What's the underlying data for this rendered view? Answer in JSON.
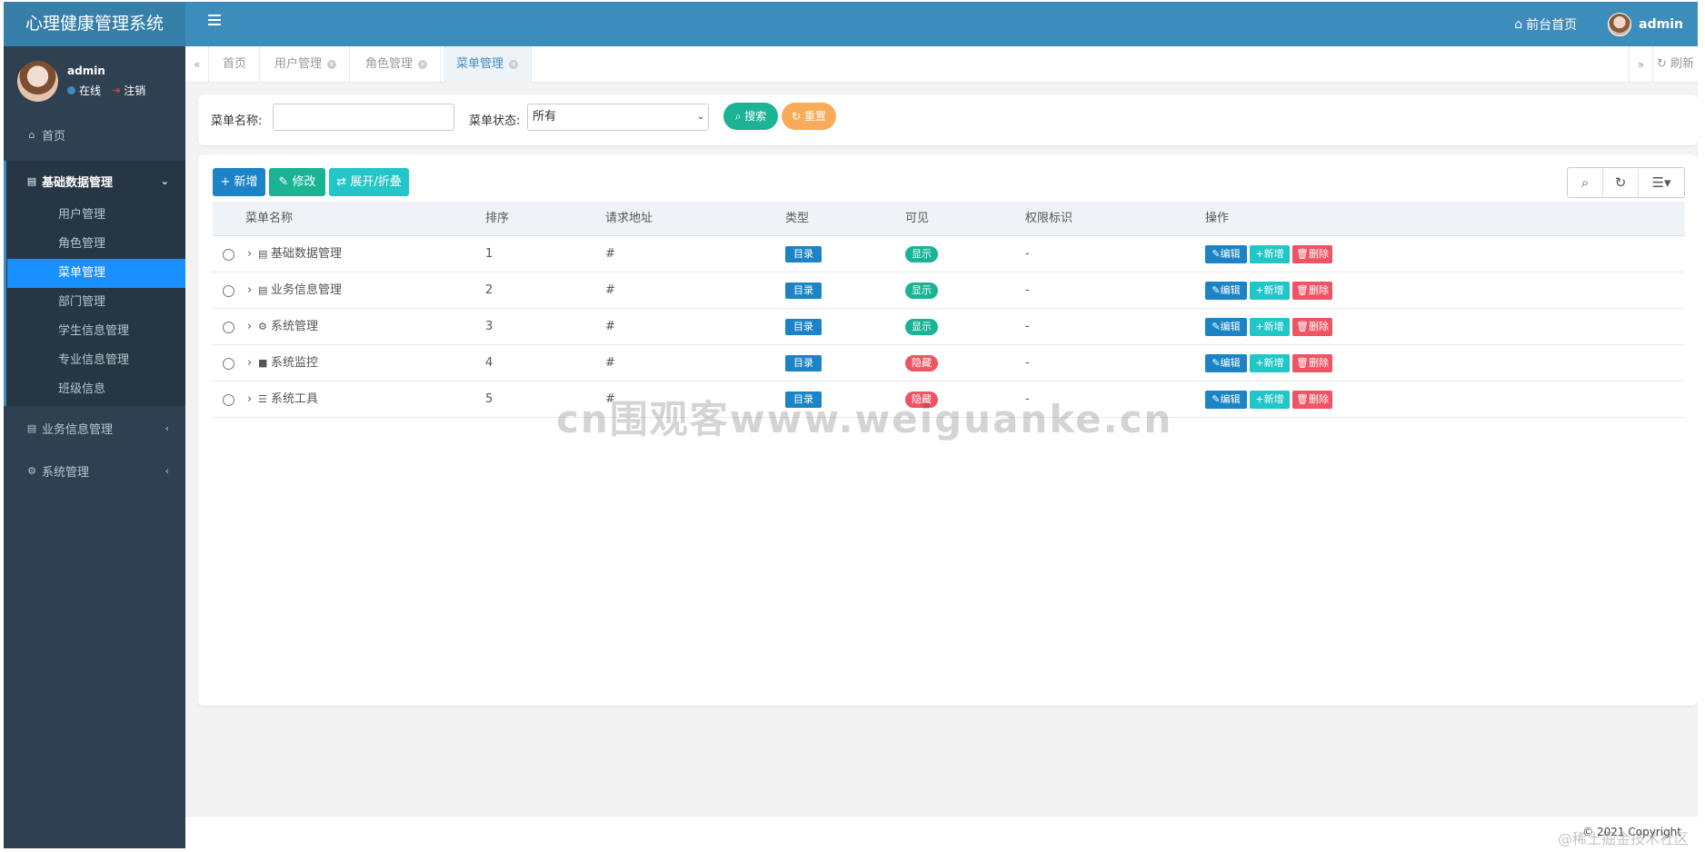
{
  "header": {
    "brand": "心理健康管理系统",
    "home_link": "前台首页",
    "user_name": "admin"
  },
  "sidebar": {
    "user": {
      "name": "admin",
      "status": "在线",
      "logout": "注销"
    },
    "home": "首页",
    "group_basic": "基础数据管理",
    "basic_items": [
      "用户管理",
      "角色管理",
      "菜单管理",
      "部门管理",
      "学生信息管理",
      "专业信息管理",
      "班级信息"
    ],
    "active_item": "菜单管理",
    "group_business": "业务信息管理",
    "group_system": "系统管理"
  },
  "tabs": {
    "items": [
      {
        "label": "首页",
        "closable": false
      },
      {
        "label": "用户管理",
        "closable": true
      },
      {
        "label": "角色管理",
        "closable": true
      },
      {
        "label": "菜单管理",
        "closable": true
      }
    ],
    "active": "菜单管理",
    "refresh": "刷新"
  },
  "search": {
    "name_label": "菜单名称:",
    "name_value": "",
    "status_label": "菜单状态:",
    "status_selected": "所有",
    "search_btn": "搜索",
    "reset_btn": "重置"
  },
  "toolbar": {
    "add": "新增",
    "edit": "修改",
    "toggle": "展开/折叠"
  },
  "table": {
    "headers": [
      "菜单名称",
      "排序",
      "请求地址",
      "类型",
      "可见",
      "权限标识",
      "操作"
    ],
    "rows": [
      {
        "name": "基础数据管理",
        "icon": "list-icon",
        "order": "1",
        "url": "#",
        "type": "目录",
        "visible": "显示",
        "perm": "-"
      },
      {
        "name": "业务信息管理",
        "icon": "list-icon",
        "order": "2",
        "url": "#",
        "type": "目录",
        "visible": "显示",
        "perm": "-"
      },
      {
        "name": "系统管理",
        "icon": "gear-icon",
        "order": "3",
        "url": "#",
        "type": "目录",
        "visible": "显示",
        "perm": "-"
      },
      {
        "name": "系统监控",
        "icon": "video-icon",
        "order": "4",
        "url": "#",
        "type": "目录",
        "visible": "隐藏",
        "perm": "-"
      },
      {
        "name": "系统工具",
        "icon": "bars-icon",
        "order": "5",
        "url": "#",
        "type": "目录",
        "visible": "隐藏",
        "perm": "-"
      }
    ],
    "actions": {
      "edit": "编辑",
      "add": "新增",
      "delete": "删除"
    }
  },
  "footer": {
    "copyright": "© 2021 Copyright"
  },
  "watermarks": {
    "center": "cn围观客www.weiguanke.cn",
    "corner": "@稀土掘金技术社区"
  },
  "colors": {
    "header": "#3c8dbc",
    "sidebar": "#2f4050",
    "active_menu": "#1890ff",
    "show": "#1ab394",
    "hide": "#ed5565",
    "dir": "#1c84c6"
  }
}
